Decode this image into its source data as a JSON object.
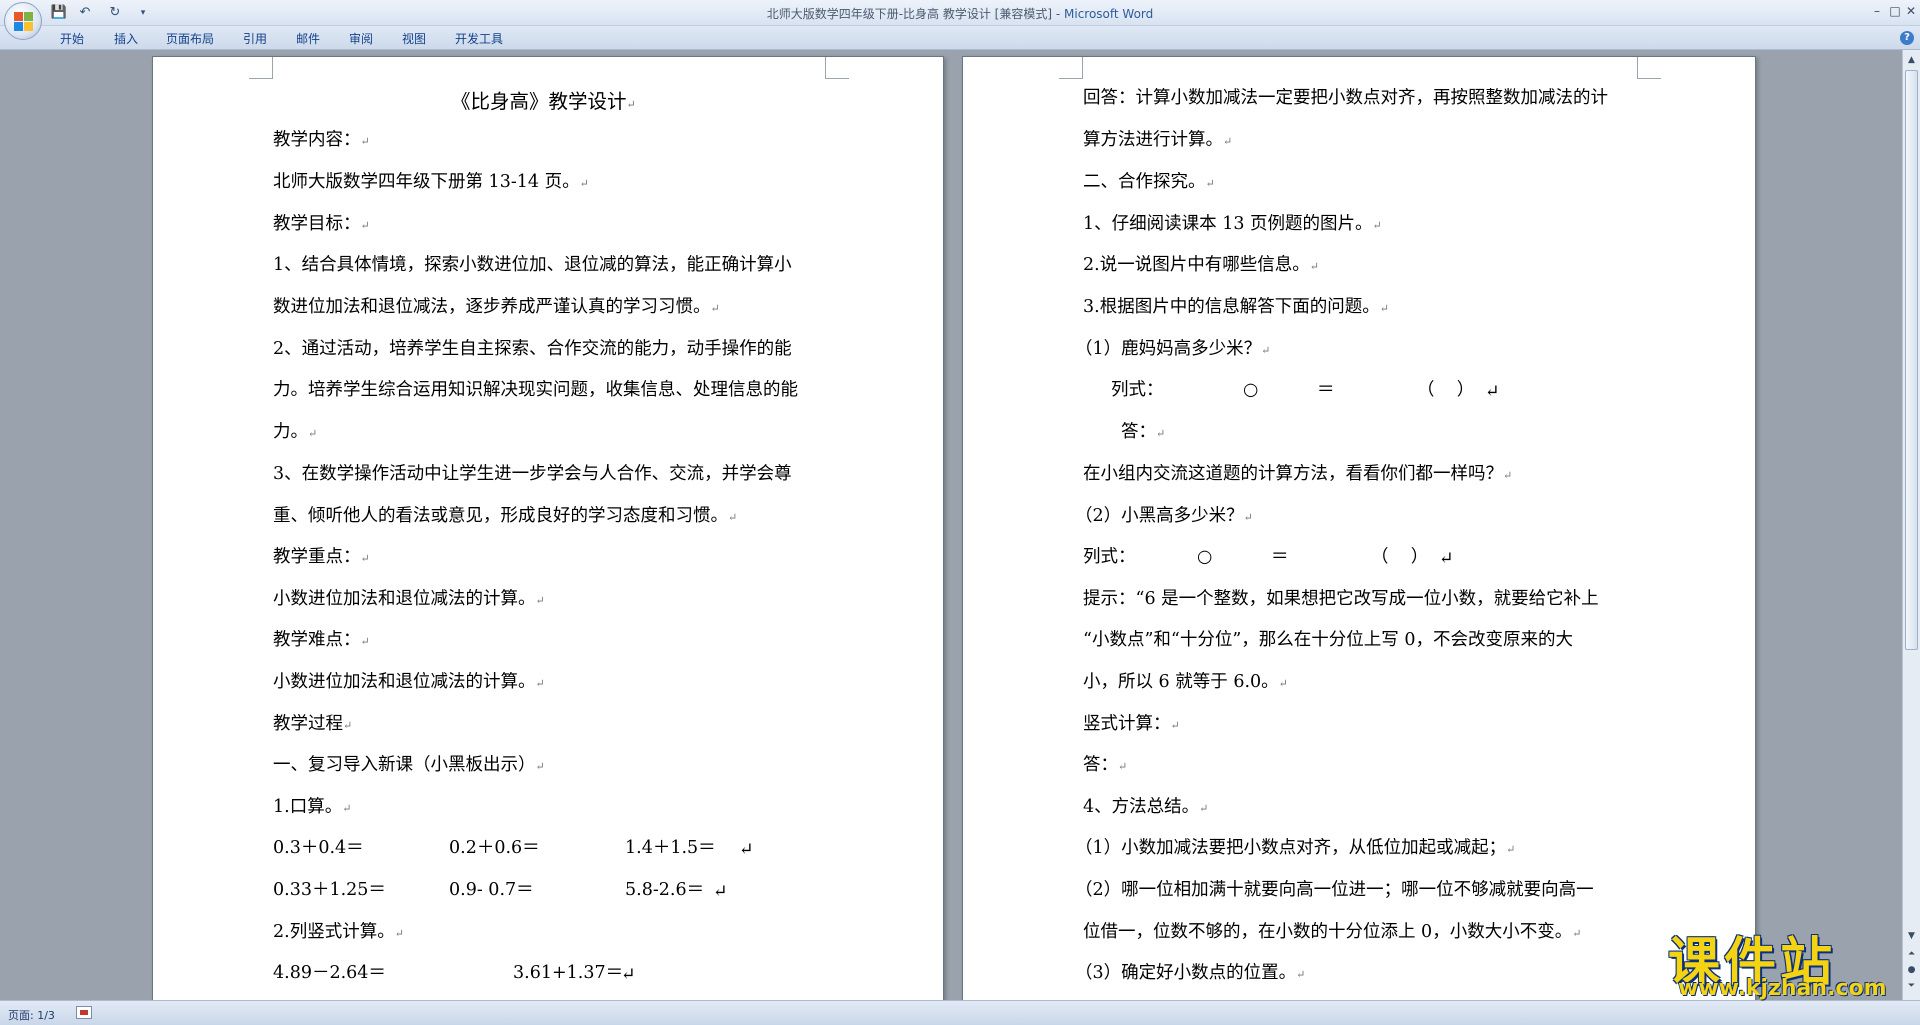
{
  "window": {
    "title": "北师大版数学四年级下册-比身高  教学设计 [兼容模式] - ",
    "app_name": "Microsoft Word",
    "minimize": "–",
    "maximize": "□",
    "close": "✕"
  },
  "quick_access": {
    "save": "💾",
    "undo": "↶",
    "redo": "↻",
    "more": "▾"
  },
  "ribbon": {
    "tabs": [
      "开始",
      "插入",
      "页面布局",
      "引用",
      "邮件",
      "审阅",
      "视图",
      "开发工具"
    ],
    "help": "?"
  },
  "page1": {
    "title": "《比身高》教学设计",
    "lines": [
      "教学内容：",
      "北师大版数学四年级下册第 13-14 页。",
      "教学目标：",
      "1、结合具体情境，探索小数进位加、退位减的算法，能正确计算小",
      "数进位加法和退位减法，逐步养成严谨认真的学习习惯。",
      "2、通过活动，培养学生自主探索、合作交流的能力，动手操作的能",
      "力。培养学生综合运用知识解决现实问题，收集信息、处理信息的能",
      "力。",
      "3、在数学操作活动中让学生进一步学会与人合作、交流，并学会尊",
      "重、倾听他人的看法或意见，形成良好的学习态度和习惯。",
      "教学重点：",
      "小数进位加法和退位减法的计算。",
      "教学难点：",
      "小数进位加法和退位减法的计算。",
      "教学过程",
      "一、复习导入新课（小黑板出示）",
      "1.口算。"
    ],
    "oral_row1": [
      "0.3＋0.4＝",
      "0.2＋0.6＝",
      "1.4＋1.5＝"
    ],
    "oral_row2": [
      "0.33＋1.25＝",
      "0.9- 0.7＝",
      "5.8-2.6＝"
    ],
    "vertical_label": "2.列竖式计算。",
    "vertical_row": [
      "4.89－2.64＝",
      "3.61+1.37＝"
    ]
  },
  "page2": {
    "lines_a": [
      "回答：计算小数加减法一定要把小数点对齐，再按照整数加减法的计",
      "算方法进行计算。",
      "二、合作探究。",
      "1、仔细阅读课本 13 页例题的图片。",
      "2.说一说图片中有哪些信息。",
      "3.根据图片中的信息解答下面的问题。",
      "（1）鹿妈妈高多少米？"
    ],
    "formula1": [
      "列式：",
      "○",
      "＝",
      "（    ）"
    ],
    "answer1": "答：",
    "lines_b": [
      "在小组内交流这道题的计算方法，看看你们都一样吗？",
      "（2）小黑高多少米？"
    ],
    "formula2": [
      "列式：",
      "○",
      "＝",
      "（    ）"
    ],
    "lines_c": [
      "提示：“6 是一个整数，如果想把它改写成一位小数，就要给它补上",
      "“小数点”和“十分位”，那么在十分位上写 0，不会改变原来的大",
      "小，所以 6 就等于 6.0。",
      "竖式计算：",
      "答：",
      "4、方法总结。",
      "（1）小数加减法要把小数点对齐，从低位加起或减起；",
      "（2）哪一位相加满十就要向高一位进一；哪一位不够减就要向高一",
      "位借一，位数不够的，在小数的十分位添上 0，小数大小不变。",
      "（3）确定好小数点的位置。"
    ]
  },
  "status": {
    "page": "页面: 1/3"
  },
  "watermark": {
    "main": "课件站",
    "url": "www.kjzhan.com"
  }
}
